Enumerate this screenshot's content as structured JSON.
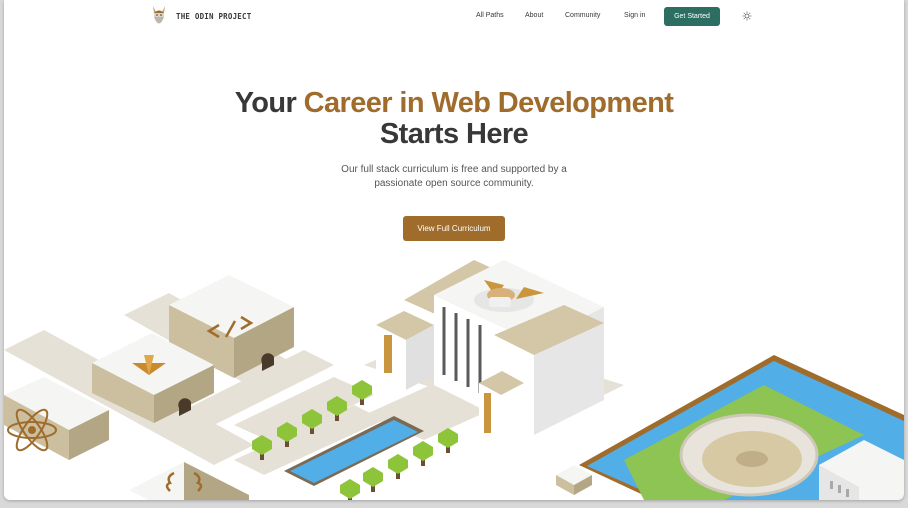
{
  "brand": {
    "name": "THE ODIN PROJECT",
    "icon": "odin-viking-logo"
  },
  "nav": {
    "links": [
      "All Paths",
      "About",
      "Community",
      "Sign in"
    ],
    "cta_label": "Get Started",
    "theme_toggle_icon": "sun-icon"
  },
  "hero": {
    "title_part1": "Your ",
    "title_accent": "Career in Web Development",
    "title_part2": "Starts Here",
    "subtitle_line1": "Our full stack curriculum is free and supported by a",
    "subtitle_line2": "passionate open source community.",
    "button_label": "View Full Curriculum"
  },
  "illustration": {
    "icons": [
      "code-brackets-icon",
      "sass-icon",
      "react-atom-icon",
      "js-braces-icon",
      "odin-logo-icon",
      "odin-colosseum-emblem"
    ]
  },
  "colors": {
    "accent": "#a06c2c",
    "cta_green": "#2c6e62",
    "text_dark": "#383838",
    "water": "#52aee6",
    "grass": "#8dc454"
  }
}
